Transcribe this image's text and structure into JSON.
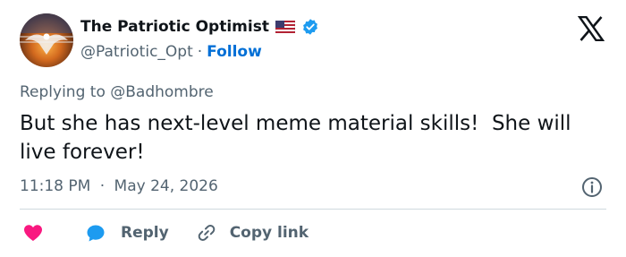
{
  "author": {
    "name": "The Patriotic Optimist",
    "handle": "@Patriotic_Opt",
    "separator": "·",
    "follow_label": "Follow"
  },
  "tweet": {
    "replying_prefix": "Replying to ",
    "replying_to": "@Badhombre",
    "text": "But she has next-level meme material skills!  She will live forever!",
    "time": "11:18 PM",
    "meta_separator": "·",
    "date": "May 24, 2026"
  },
  "actions": {
    "reply_label": "Reply",
    "copy_link_label": "Copy link"
  },
  "colors": {
    "link_blue": "#006fd6",
    "heart_red": "#f91880",
    "reply_blue": "#1d9bf0",
    "muted": "#536471"
  },
  "icons": [
    "x-logo-icon",
    "verified-badge-icon",
    "us-flag-icon",
    "info-icon",
    "heart-icon",
    "reply-bubble-icon",
    "link-icon"
  ]
}
